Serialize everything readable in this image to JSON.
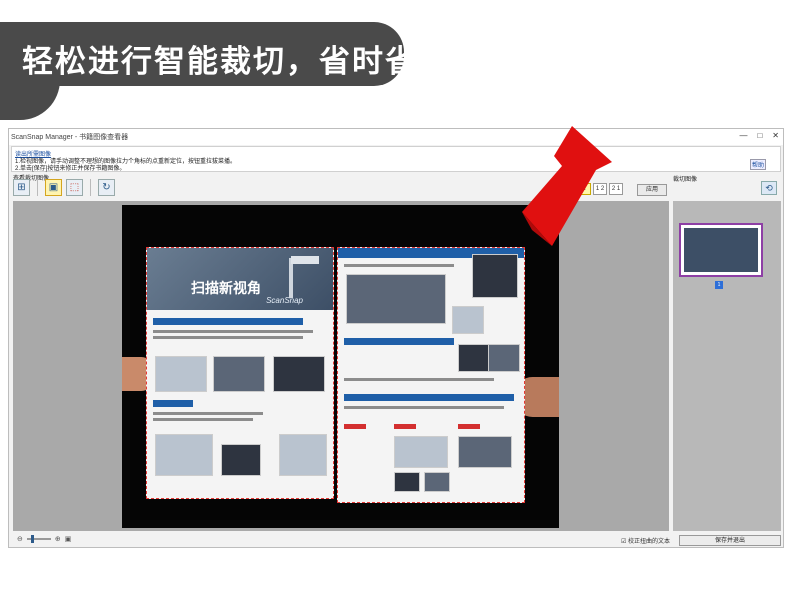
{
  "banner": {
    "text": "轻松进行智能裁切，省时省力"
  },
  "window": {
    "title": "ScanSnap Manager - 书籍图像查看器",
    "controls": {
      "min": "—",
      "max": "□",
      "close": "✕"
    }
  },
  "info": {
    "link": "读出所需图像",
    "line1": "1.检视图像，请手动调整不理想的图像拉力个角标的点重新定位，按钮重拉拔菜播。",
    "line2": "2.单击[保存]按钮来修正并保存书籍图像。",
    "help": "帮助"
  },
  "labels": {
    "preview": "查看裁切图像",
    "thumbnails": "裁切图像"
  },
  "layout_buttons": [
    "1",
    "1 2",
    "2 1"
  ],
  "apply_label": "应用",
  "page": {
    "hero_title": "扫描新视角",
    "brand": "ScanSnap"
  },
  "thumb": {
    "badge": "1"
  },
  "status": {
    "checkbox_label": "☑ 校正扭曲的文本",
    "save_close": "保存并退出"
  },
  "colors": {
    "accent": "#1f5fa8",
    "crop_outline": "#e53935",
    "arrow": "#e01010",
    "banner": "#4a4a4a"
  }
}
